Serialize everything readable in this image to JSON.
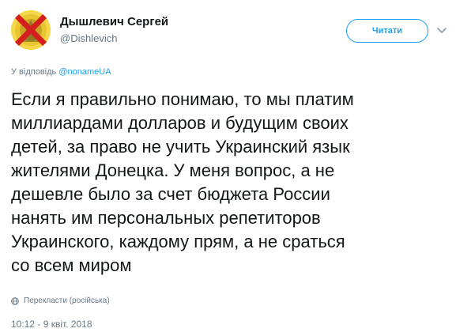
{
  "user": {
    "name": "Дышлевич Сергей",
    "handle": "@Dishlevich"
  },
  "follow_button": {
    "label": "Читати"
  },
  "reply": {
    "prefix": "У відповідь ",
    "mention": "@nonameUA"
  },
  "tweet": {
    "lines": [
      "Если я правильно понимаю, то мы платим",
      "миллиардами долларов и будущим своих",
      "детей, за право не учить Украинский язык",
      "жителями Донецка. У меня вопрос, а не",
      "дешевле было за счет бюджета России",
      "нанять им персональных репетиторов",
      "Украинского, каждому прям, а не сраться",
      "со всем миром"
    ]
  },
  "translate": {
    "label": "Перекласти (російська)"
  },
  "timestamp": "10:12 - 9 квіт. 2018",
  "colors": {
    "accent": "#1da1f2",
    "text": "#14171a",
    "muted": "#657786",
    "avatar_bg": "#e8c531",
    "avatar_cross": "#d41f1f"
  },
  "icons": {
    "caret": "chevron-down-icon",
    "translate": "globe-icon"
  }
}
